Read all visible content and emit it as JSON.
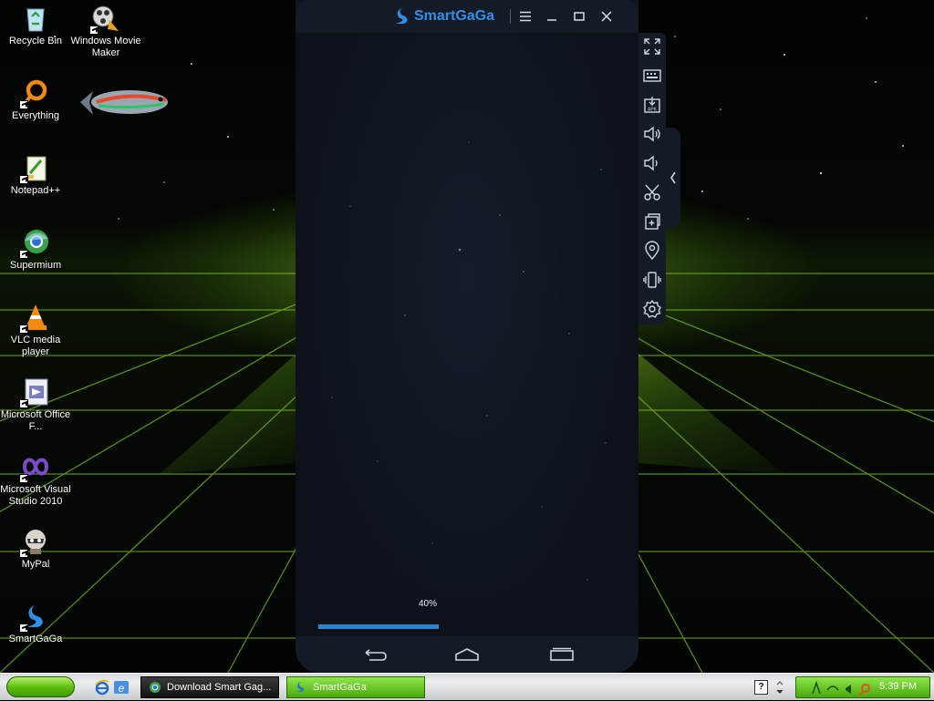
{
  "desktop": {
    "icons": [
      {
        "label": "Recycle Bin"
      },
      {
        "label": "Windows Movie Maker"
      },
      {
        "label": "Everything"
      },
      {
        "label": "Notepad++"
      },
      {
        "label": "Supermium"
      },
      {
        "label": "VLC media player"
      },
      {
        "label": "Microsoft Office F..."
      },
      {
        "label": "Microsoft Visual Studio 2010"
      },
      {
        "label": "MyPal"
      },
      {
        "label": "SmartGaGa"
      }
    ]
  },
  "emulator": {
    "title": "SmartGaGa",
    "progress_text": "40%",
    "progress_value": 0.4,
    "accent_color": "#2f8fe6",
    "sidebar_tools": [
      "fullscreen-icon",
      "keyboard-icon",
      "install-apk-icon",
      "volume-up-icon",
      "volume-down-icon",
      "screenshot-icon",
      "multi-instance-icon",
      "location-icon",
      "shake-icon",
      "settings-icon"
    ]
  },
  "taskbar": {
    "tasks": [
      {
        "label": "Download Smart Gag..."
      },
      {
        "label": "SmartGaGa"
      }
    ],
    "clock": "5:39 PM"
  }
}
